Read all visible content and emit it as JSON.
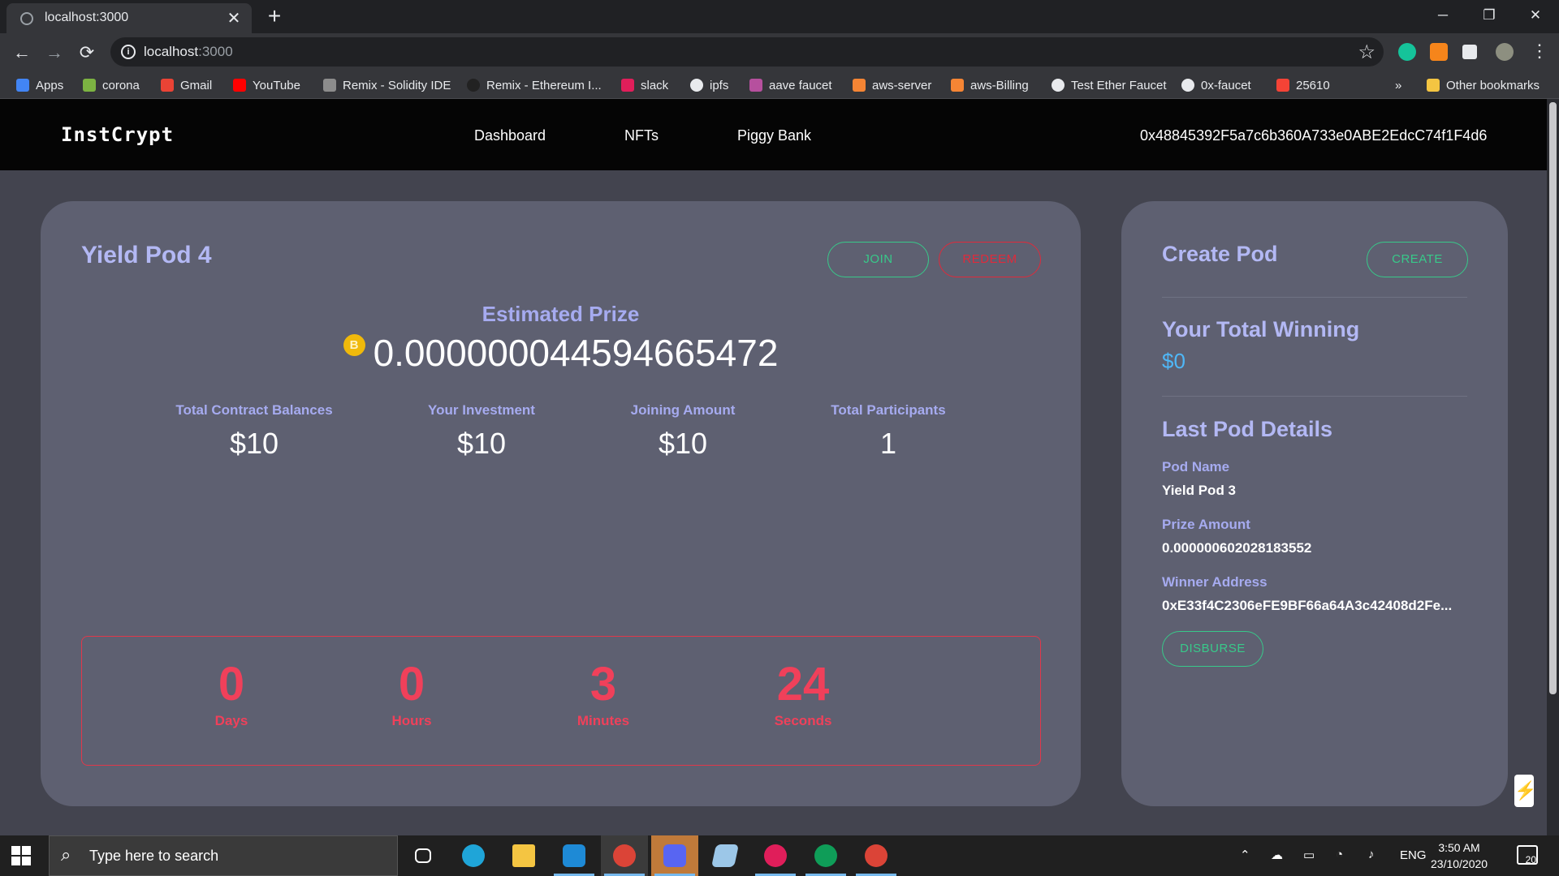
{
  "browser": {
    "tab_title": "localhost:3000",
    "tab_close": "✕",
    "new_tab": "+",
    "window_controls": {
      "minimize": "─",
      "restore": "❐",
      "close": "✕"
    },
    "nav": {
      "back": "←",
      "forward": "→",
      "reload": "⟳"
    },
    "url_host": "localhost",
    "url_port": ":3000",
    "star": "☆",
    "menu": "⋮",
    "bookmarks": [
      {
        "label": "Apps",
        "icon": "apps-grid-icon",
        "color": "#4285f4"
      },
      {
        "label": "corona",
        "icon": "corona-icon",
        "color": "#7cb342"
      },
      {
        "label": "Gmail",
        "icon": "gmail-icon",
        "color": "#ea4335"
      },
      {
        "label": "YouTube",
        "icon": "youtube-icon",
        "color": "#ff0000"
      },
      {
        "label": "Remix - Solidity IDE",
        "icon": "ethereum-icon",
        "color": "#8c8c8c"
      },
      {
        "label": "Remix - Ethereum I...",
        "icon": "remix-icon",
        "color": "#222222"
      },
      {
        "label": "slack",
        "icon": "slack-icon",
        "color": "#e01e5a"
      },
      {
        "label": "ipfs",
        "icon": "globe-icon",
        "color": "#e8eaed"
      },
      {
        "label": "aave faucet",
        "icon": "aave-icon",
        "color": "#b6509e"
      },
      {
        "label": "aws-server",
        "icon": "aws-icon",
        "color": "#f58534"
      },
      {
        "label": "aws-Billing",
        "icon": "aws-icon",
        "color": "#f58534"
      },
      {
        "label": "Test Ether Faucet",
        "icon": "globe-icon",
        "color": "#e8eaed"
      },
      {
        "label": "0x-faucet",
        "icon": "github-icon",
        "color": "#e8eaed"
      },
      {
        "label": "25610",
        "icon": "codeforces-icon",
        "color": "#f44336"
      }
    ],
    "bookmarks_overflow": "»",
    "other_bookmarks": "Other bookmarks"
  },
  "app": {
    "brand": "InstCrypt",
    "nav": [
      "Dashboard",
      "NFTs",
      "Piggy Bank"
    ],
    "wallet_address": "0x48845392F5a7c6b360A733e0ABE2EdcC74f1F4d6"
  },
  "pod": {
    "title": "Yield Pod 4",
    "join_label": "JOIN",
    "redeem_label": "REDEEM",
    "estimated_prize_label": "Estimated Prize",
    "estimated_prize_value": "0.000000044594665472",
    "stats": [
      {
        "label": "Total Contract Balances",
        "value": "$10"
      },
      {
        "label": "Your Investment",
        "value": "$10"
      },
      {
        "label": "Joining Amount",
        "value": "$10"
      },
      {
        "label": "Total Participants",
        "value": "1"
      }
    ],
    "timer": [
      {
        "value": "0",
        "label": "Days"
      },
      {
        "value": "0",
        "label": "Hours"
      },
      {
        "value": "3",
        "label": "Minutes"
      },
      {
        "value": "24",
        "label": "Seconds"
      }
    ]
  },
  "side": {
    "create_title": "Create Pod",
    "create_label": "CREATE",
    "winning_title": "Your Total Winning",
    "winning_value": "$0",
    "last_pod_title": "Last Pod Details",
    "pod_name_label": "Pod Name",
    "pod_name_value": "Yield Pod 3",
    "prize_amount_label": "Prize Amount",
    "prize_amount_value": "0.000000602028183552",
    "winner_address_label": "Winner Address",
    "winner_address_value": "0xE33f4C2306eFE9BF66a64A3c42408d2Fe...",
    "disburse_label": "DISBURSE"
  },
  "taskbar": {
    "search_placeholder": "Type here to search",
    "tray_lang": "ENG",
    "time": "3:50 AM",
    "date": "23/10/2020",
    "notification_count": "20"
  },
  "colors": {
    "card_bg": "#5e6071",
    "page_bg": "#43444f",
    "accent_green": "#38c98a",
    "accent_red": "#e02a3b",
    "label_lavender": "#a6abf0",
    "money_blue": "#4fb7f7"
  }
}
